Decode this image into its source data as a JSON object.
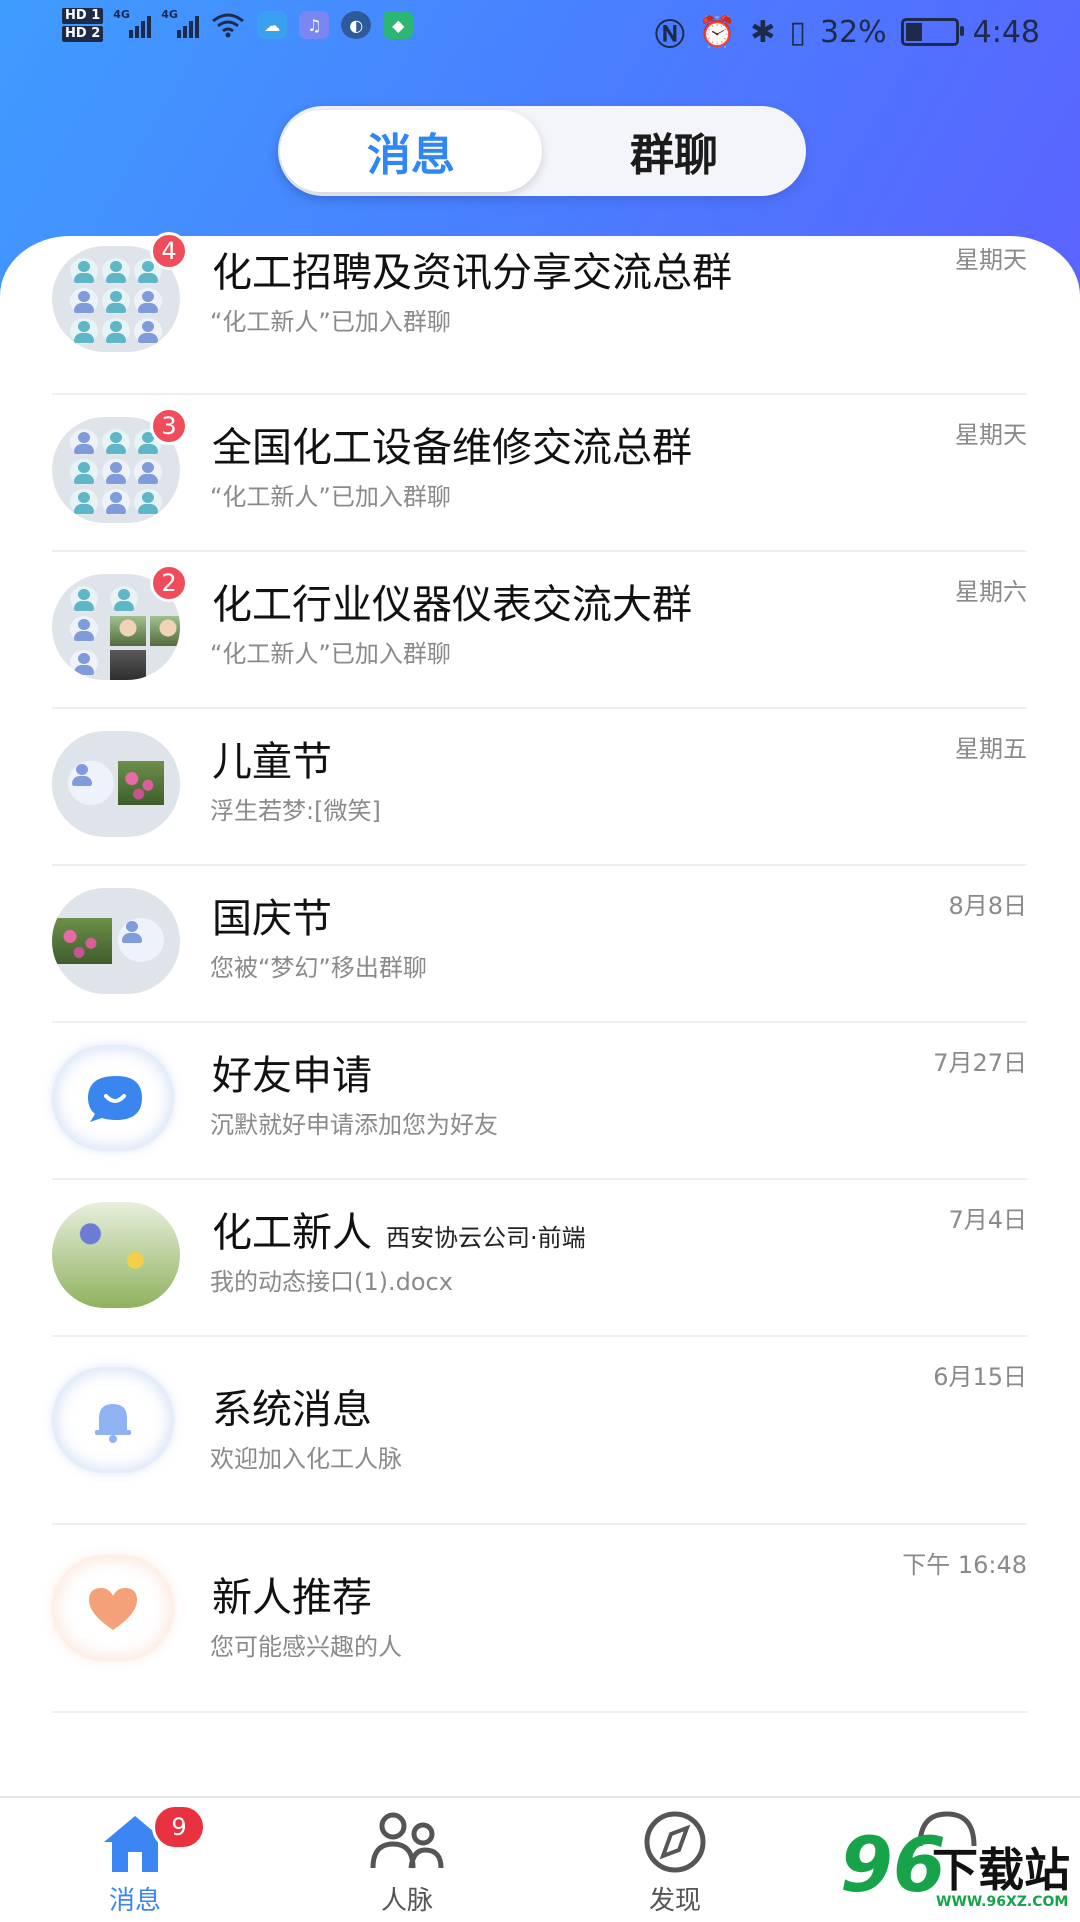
{
  "status_bar": {
    "sim_labels": [
      "HD 1",
      "HD 2"
    ],
    "network_labels": [
      "4G",
      "4G"
    ],
    "battery_percent": "32%",
    "battery_level": 0.32,
    "time": "4:48"
  },
  "segment": {
    "tabs": [
      "消息",
      "群聊"
    ],
    "active_index": 0
  },
  "conversations": [
    {
      "title": "化工招聘及资讯分享交流总群",
      "preview": "“化工新人”已加入群聊",
      "time": "星期天",
      "badge": "4"
    },
    {
      "title": "全国化工设备维修交流总群",
      "preview": "“化工新人”已加入群聊",
      "time": "星期天",
      "badge": "3"
    },
    {
      "title": "化工行业仪器仪表交流大群",
      "preview": "“化工新人”已加入群聊",
      "time": "星期六",
      "badge": "2"
    },
    {
      "title": "儿童节",
      "preview": "浮生若梦:[微笑]",
      "time": "星期五"
    },
    {
      "title": "国庆节",
      "preview": "您被“梦幻”移出群聊",
      "time": "8月8日"
    },
    {
      "title": "好友申请",
      "preview": "沉默就好申请添加您为好友",
      "time": "7月27日"
    },
    {
      "title": "化工新人",
      "subtitle": "西安协云公司·前端",
      "preview": "我的动态接口(1).docx",
      "time": "7月4日"
    },
    {
      "title": "系统消息",
      "preview": "欢迎加入化工人脉",
      "time": "6月15日"
    },
    {
      "title": "新人推荐",
      "preview": "您可能感兴趣的人",
      "time": "下午 16:48"
    }
  ],
  "bottom_nav": {
    "items": [
      {
        "label": "消息",
        "icon": "home-icon",
        "badge": "9"
      },
      {
        "label": "人脉",
        "icon": "contacts-icon"
      },
      {
        "label": "发现",
        "icon": "compass-icon"
      }
    ]
  },
  "watermark": {
    "text": "96下载站",
    "url_text": "WWW.96XZ.COM"
  },
  "colors": {
    "accent": "#2f86f5",
    "badge": "#ef4d5c",
    "header_gradient_start": "#3f9cff",
    "header_gradient_end": "#5b63ff"
  }
}
